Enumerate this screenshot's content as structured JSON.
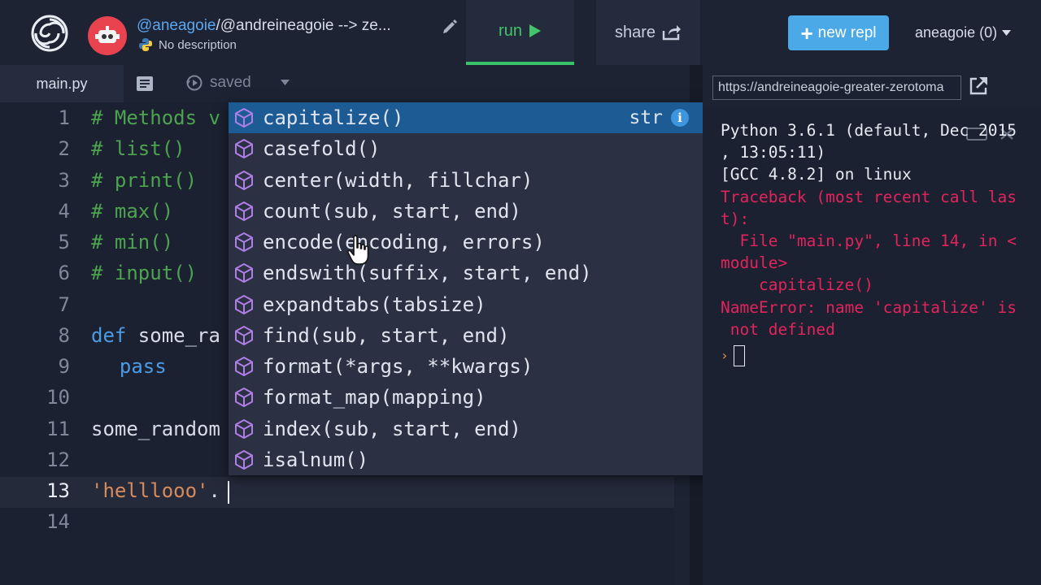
{
  "header": {
    "owner": "@aneagoie",
    "repl_name": "/@andreineagoie --> ze...",
    "description": "No description",
    "run_label": "run",
    "share_label": "share",
    "new_repl_label": "new repl",
    "user_menu_label": "aneagoie (0)"
  },
  "editor": {
    "tab_label": "main.py",
    "save_status": "saved",
    "line_numbers": [
      "1",
      "2",
      "3",
      "4",
      "5",
      "6",
      "7",
      "8",
      "9",
      "10",
      "11",
      "12",
      "13",
      "14"
    ],
    "code": {
      "l1": "# Methods v",
      "l2": "# list()",
      "l3": "# print()",
      "l4": "# max()",
      "l5": "# min()",
      "l6": "# input()",
      "l8_kw": "def",
      "l8_name": " some_ra",
      "l9": "  pass",
      "l11": "some_random",
      "l13_str": "'helllooo'",
      "l13_dot": "."
    }
  },
  "autocomplete": {
    "type_label": "str",
    "info_label": "i",
    "items": [
      "capitalize()",
      "casefold()",
      "center(width, fillchar)",
      "count(sub, start, end)",
      "encode(encoding, errors)",
      "endswith(suffix, start, end)",
      "expandtabs(tabsize)",
      "find(sub, start, end)",
      "format(*args, **kwargs)",
      "format_map(mapping)",
      "index(sub, start, end)",
      "isalnum()"
    ],
    "item_icon": "method-cube-icon",
    "selected_index": 0
  },
  "console": {
    "url": "https://andreineagoie-greater-zerotoma",
    "lines": [
      "Python 3.6.1 (default, Dec 2015",
      ", 13:05:11)",
      "[GCC 4.8.2] on linux"
    ],
    "error_lines": [
      "Traceback (most recent call las",
      "t):",
      "  File \"main.py\", line 14, in <",
      "module>",
      "    capitalize()",
      "NameError: name 'capitalize' is",
      " not defined"
    ]
  },
  "colors": {
    "accent_run": "#43c46b",
    "accent_new_repl": "#4aa9e6",
    "selection": "#1d5b95",
    "error": "#e2245d",
    "comment": "#4da34f",
    "keyword": "#4a9ce6",
    "string": "#d78b5b"
  }
}
